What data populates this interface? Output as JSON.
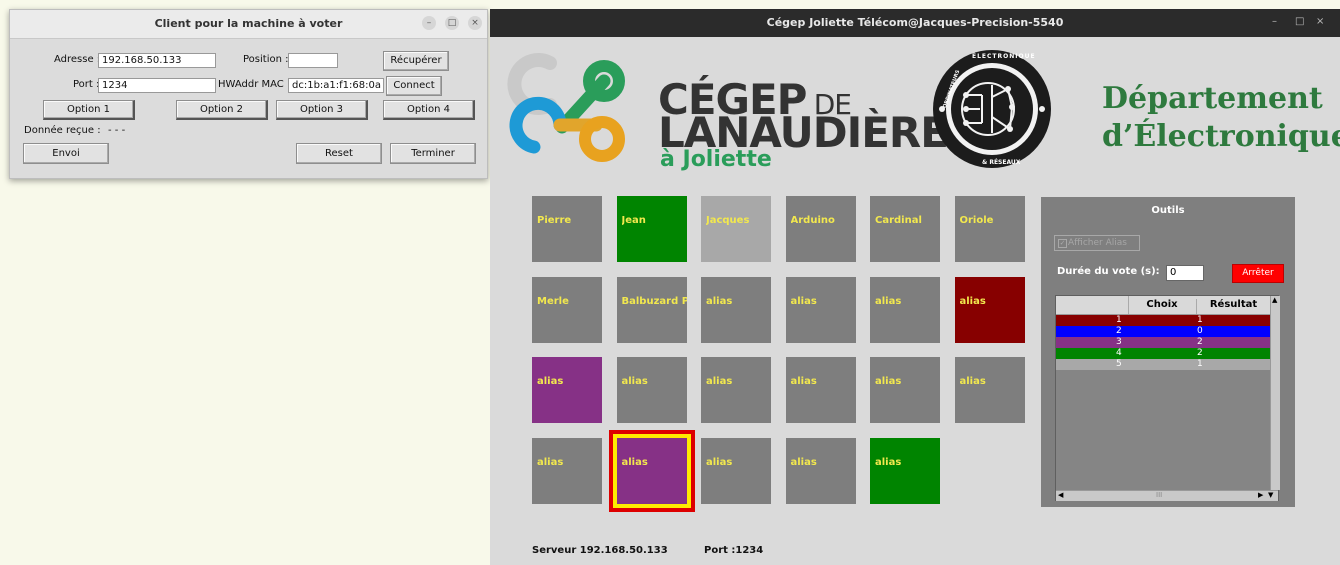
{
  "client_window": {
    "title": "Client pour la machine à voter",
    "controls": [
      "–",
      "□",
      "×"
    ],
    "address_label": "Adresse :",
    "address_value": "192.168.50.133",
    "position_label": "Position :",
    "position_value": "",
    "recuperer_label": "Récupérer",
    "port_label": "Port :",
    "port_value": "1234",
    "mac_label": "HWAddr MAC :",
    "mac_value": "dc:1b:a1:f1:68:0a",
    "connect_label": "Connect",
    "options": [
      "Option 1",
      "Option 2",
      "Option 3",
      "Option 4"
    ],
    "received_label": "Donnée reçue :",
    "received_value": "- - -",
    "envoi_label": "Envoi",
    "reset_label": "Reset",
    "terminer_label": "Terminer"
  },
  "main_window": {
    "title": "Cégep Joliette Télécom@Jacques-Precision-5540",
    "controls": [
      "–",
      "□",
      "×"
    ],
    "logo": {
      "line1": "CÉGEP",
      "line1_suffix": "DE",
      "line2": "LANAUDIÈRE",
      "line3": "à Joliette"
    },
    "seal": {
      "top_text": "ÉLECTRONIQUE",
      "left_text": "ORDINATEURS",
      "bottom_text": "& RÉSEAUX"
    },
    "department": {
      "line1": "Département",
      "line2": "d’Électronique"
    },
    "tiles": [
      {
        "label": "Pierre",
        "color": "#7e7e7e"
      },
      {
        "label": "Jean",
        "color": "#008400"
      },
      {
        "label": "Jacques",
        "color": "#a8a8a8"
      },
      {
        "label": "Arduino",
        "color": "#7e7e7e"
      },
      {
        "label": "Cardinal",
        "color": "#7e7e7e"
      },
      {
        "label": "Oriole",
        "color": "#7e7e7e"
      },
      {
        "label": "Merle",
        "color": "#7e7e7e"
      },
      {
        "label": "Balbuzard P",
        "color": "#7e7e7e"
      },
      {
        "label": "alias",
        "color": "#7e7e7e"
      },
      {
        "label": "alias",
        "color": "#7e7e7e"
      },
      {
        "label": "alias",
        "color": "#7e7e7e"
      },
      {
        "label": "alias",
        "color": "#870000"
      },
      {
        "label": "alias",
        "color": "#863186"
      },
      {
        "label": "alias",
        "color": "#7e7e7e"
      },
      {
        "label": "alias",
        "color": "#7e7e7e"
      },
      {
        "label": "alias",
        "color": "#7e7e7e"
      },
      {
        "label": "alias",
        "color": "#7e7e7e"
      },
      {
        "label": "alias",
        "color": "#7e7e7e"
      },
      {
        "label": "alias",
        "color": "#7e7e7e"
      },
      {
        "label": "alias",
        "color": "#863186",
        "selected": true
      },
      {
        "label": "alias",
        "color": "#7e7e7e"
      },
      {
        "label": "alias",
        "color": "#7e7e7e"
      },
      {
        "label": "alias",
        "color": "#008400"
      }
    ],
    "tools": {
      "title": "Outils",
      "afficher_alias_label": "Afficher Alias",
      "afficher_alias_checked": true,
      "duree_label": "Durée du vote (s):",
      "duree_value": "0",
      "arreter_label": "Arrêter",
      "columns": [
        "Choix",
        "Résultat"
      ],
      "rows": [
        {
          "choix": "1",
          "resultat": "1",
          "color": "#870000"
        },
        {
          "choix": "2",
          "resultat": "0",
          "color": "#0000ff"
        },
        {
          "choix": "3",
          "resultat": "2",
          "color": "#863186"
        },
        {
          "choix": "4",
          "resultat": "2",
          "color": "#008400"
        },
        {
          "choix": "5",
          "resultat": "1",
          "color": "#a8a8a8"
        }
      ],
      "scroll_glyph": "III"
    },
    "footer": {
      "server_label": "Serveur 192.168.50.133",
      "port_label": "Port :1234"
    }
  }
}
